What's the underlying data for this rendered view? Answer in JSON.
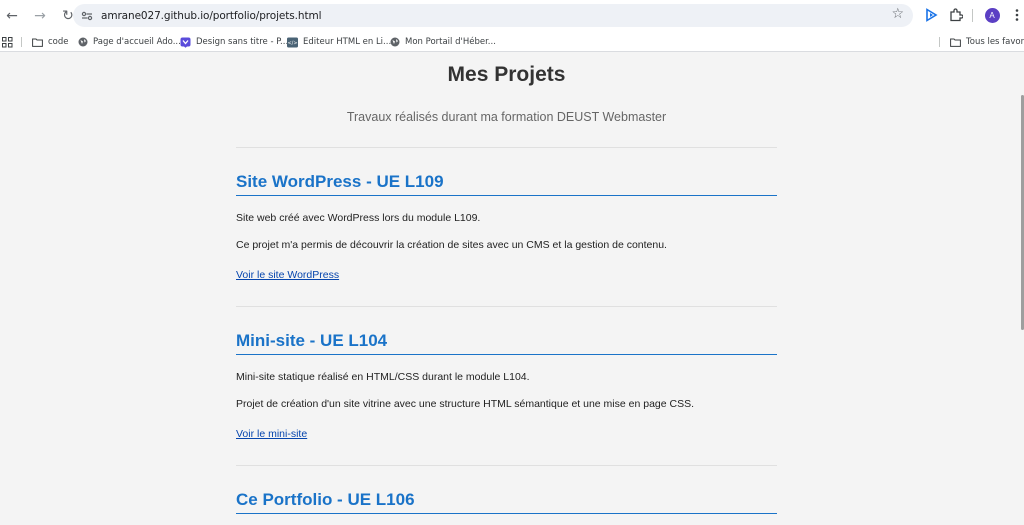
{
  "browser": {
    "url": "amrane027.github.io/portfolio/projets.html",
    "profile_initial": "A",
    "bookmarks": [
      {
        "label": "code",
        "icon": "folder-icon"
      },
      {
        "label": "Page d'accueil Ado...",
        "icon": "globe-icon"
      },
      {
        "label": "Design sans titre - P...",
        "icon": "canva-icon"
      },
      {
        "label": "Editeur HTML en Li...",
        "icon": "html-editor-icon"
      },
      {
        "label": "Mon Portail d'Héber...",
        "icon": "globe-icon"
      }
    ],
    "all_bookmarks_label": "Tous les favoris"
  },
  "page": {
    "title": "Mes Projets",
    "subtitle": "Travaux réalisés durant ma formation DEUST Webmaster",
    "projects": [
      {
        "title": "Site WordPress - UE L109",
        "paragraphs": [
          "Site web créé avec WordPress lors du module L109.",
          "Ce projet m'a permis de découvrir la création de sites avec un CMS et la gestion de contenu."
        ],
        "link": "Voir le site WordPress"
      },
      {
        "title": "Mini-site - UE L104",
        "paragraphs": [
          "Mini-site statique réalisé en HTML/CSS durant le module L104.",
          "Projet de création d'un site vitrine avec une structure HTML sémantique et une mise en page CSS."
        ],
        "link": "Voir le mini-site"
      },
      {
        "title": "Ce Portfolio - UE L106"
      }
    ]
  },
  "colors": {
    "heading_blue": "#1a73c8",
    "link_blue": "#0645ad",
    "page_bg": "#f4f4f4"
  }
}
